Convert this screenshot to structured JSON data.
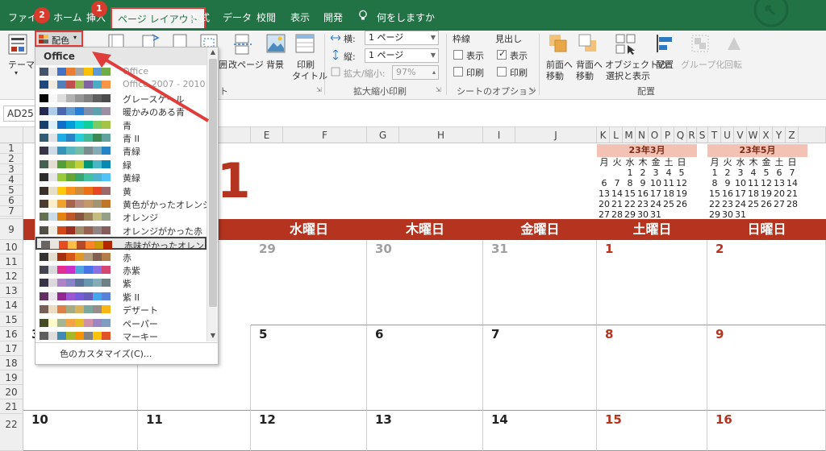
{
  "tabs": {
    "file": "ファイル",
    "home": "ホーム",
    "insert": "挿入",
    "page_layout": "ページ レイアウト",
    "formulas": "数式",
    "data": "データ",
    "review": "校閲",
    "view": "表示",
    "developer": "開発",
    "tell_me": "何をしますか"
  },
  "badges": {
    "one": "1",
    "two": "2"
  },
  "ribbon": {
    "theme_label": "テーマ",
    "colors_label": "配色",
    "range_label": "囲",
    "page_break_label": "改ページ",
    "background_label": "背景",
    "print_titles_label": "印刷",
    "print_titles_label2": "タイトル",
    "width_label": "横:",
    "width_value": "1 ページ",
    "height_label": "縦:",
    "height_value": "1 ページ",
    "scale_label": "拡大/縮小:",
    "scale_value": "97%",
    "fit_group": "拡大縮小印刷",
    "gridlines_label": "枠線",
    "headings_label": "見出し",
    "gridlines_view": "表示",
    "gridlines_print": "印刷",
    "headings_view": "表示",
    "headings_print": "印刷",
    "sheet_options_group": "シートのオプション",
    "bring_forward": "前面へ",
    "bring_forward2": "移動",
    "send_backward": "背面へ",
    "send_backward2": "移動",
    "selection_pane": "オブジェクトの",
    "selection_pane2": "選択と表示",
    "align": "配置",
    "group": "グループ化",
    "rotate": "回転",
    "arrange_group": "配置",
    "partial_group": "ト"
  },
  "namebox": "AD25",
  "columns": [
    "E",
    "F",
    "G",
    "H",
    "I",
    "J",
    "K",
    "L",
    "M",
    "N",
    "O",
    "P",
    "Q",
    "R",
    "S",
    "T",
    "U",
    "V",
    "W",
    "X",
    "Y",
    "Z"
  ],
  "rows": [
    "1",
    "2",
    "3",
    "4",
    "5",
    "6",
    "7",
    "8",
    "9",
    "10",
    "11",
    "12",
    "13",
    "14",
    "15",
    "16",
    "17",
    "18",
    "19",
    "20",
    "21",
    "22"
  ],
  "title_fragment": "/1",
  "mini_march": {
    "title": "23年3月",
    "weekdays": [
      "月",
      "火",
      "水",
      "木",
      "金",
      "土",
      "日"
    ],
    "weeks": [
      [
        "",
        "",
        "1",
        "2",
        "3",
        "4",
        "5"
      ],
      [
        "6",
        "7",
        "8",
        "9",
        "10",
        "11",
        "12"
      ],
      [
        "13",
        "14",
        "15",
        "16",
        "17",
        "18",
        "19"
      ],
      [
        "20",
        "21",
        "22",
        "23",
        "24",
        "25",
        "26"
      ],
      [
        "27",
        "28",
        "29",
        "30",
        "31",
        "",
        ""
      ]
    ]
  },
  "mini_may": {
    "title": "23年5月",
    "weekdays": [
      "月",
      "火",
      "水",
      "木",
      "金",
      "土",
      "日"
    ],
    "weeks": [
      [
        "1",
        "2",
        "3",
        "4",
        "5",
        "6",
        "7"
      ],
      [
        "8",
        "9",
        "10",
        "11",
        "12",
        "13",
        "14"
      ],
      [
        "15",
        "16",
        "17",
        "18",
        "19",
        "20",
        "21"
      ],
      [
        "22",
        "23",
        "24",
        "25",
        "26",
        "27",
        "28"
      ],
      [
        "29",
        "30",
        "31",
        "",
        "",
        "",
        ""
      ]
    ]
  },
  "daynames": [
    "水曜日",
    "木曜日",
    "金曜日",
    "土曜日",
    "日曜日"
  ],
  "calendar": {
    "week1": [
      "29",
      "30",
      "31",
      "1",
      "2"
    ],
    "week2": [
      "3",
      "5",
      "6",
      "7",
      "8",
      "9"
    ],
    "week3": [
      "10",
      "11",
      "12",
      "13",
      "14",
      "15",
      "16"
    ]
  },
  "dropdown": {
    "header": "Office",
    "customize": "色のカスタマイズ(C)...",
    "schemes": [
      {
        "name": "Office",
        "faded": true,
        "colors": [
          "#44546a",
          "#e7e6e6",
          "#4472c4",
          "#ed7d31",
          "#a5a5a5",
          "#ffc000",
          "#5b9bd5",
          "#70ad47"
        ]
      },
      {
        "name": "Office 2007 - 2010",
        "faded": true,
        "colors": [
          "#1f497d",
          "#eeece1",
          "#4f81bd",
          "#c0504d",
          "#9bbb59",
          "#8064a2",
          "#4bacc6",
          "#f79646"
        ]
      },
      {
        "name": "グレースケール",
        "colors": [
          "#000000",
          "#f8f8f8",
          "#dddddd",
          "#b2b2b2",
          "#969696",
          "#808080",
          "#5f5f5f",
          "#4d4d4d"
        ]
      },
      {
        "name": "暖かみのある青",
        "colors": [
          "#242852",
          "#acccea",
          "#4a66ac",
          "#629dd1",
          "#297fd5",
          "#7f8fa9",
          "#5aa2ae",
          "#9d90a0"
        ]
      },
      {
        "name": "青",
        "colors": [
          "#17406d",
          "#dbeff9",
          "#0f6fc6",
          "#009dd9",
          "#0bd0d9",
          "#10cf9b",
          "#7cca62",
          "#a5c249"
        ]
      },
      {
        "name": "青 II",
        "colors": [
          "#335b74",
          "#dfe3e5",
          "#1cade4",
          "#2683c6",
          "#27ced7",
          "#42ba97",
          "#3e8853",
          "#62a39f"
        ]
      },
      {
        "name": "青緑",
        "colors": [
          "#373545",
          "#cedbe6",
          "#3494ba",
          "#58b6c0",
          "#75bda7",
          "#7a8c8e",
          "#84acb6",
          "#2683c6"
        ]
      },
      {
        "name": "緑",
        "colors": [
          "#455f51",
          "#e3ded1",
          "#549e39",
          "#8ab833",
          "#c0cf3a",
          "#029676",
          "#4ab5c4",
          "#0989b1"
        ]
      },
      {
        "name": "黄緑",
        "colors": [
          "#2c2c2c",
          "#e6e6e6",
          "#99cb38",
          "#63a537",
          "#37a76f",
          "#44c1a3",
          "#4eb3cf",
          "#51c3f9"
        ]
      },
      {
        "name": "黄",
        "colors": [
          "#39302a",
          "#e5dec9",
          "#ffca08",
          "#f8931d",
          "#ce8d3e",
          "#ec7016",
          "#e64823",
          "#9c6a6a"
        ]
      },
      {
        "name": "黄色がかったオレンジ",
        "colors": [
          "#4e3b30",
          "#fbeec9",
          "#f0a22e",
          "#a5644e",
          "#b58b80",
          "#c3986d",
          "#a19574",
          "#c17529"
        ]
      },
      {
        "name": "オレンジ",
        "colors": [
          "#637052",
          "#ccddea",
          "#e48312",
          "#bd582c",
          "#865640",
          "#9b8357",
          "#c2bc80",
          "#94a088"
        ]
      },
      {
        "name": "オレンジがかった赤",
        "colors": [
          "#505046",
          "#eeece1",
          "#d34817",
          "#9b2d1f",
          "#a28e6a",
          "#956251",
          "#918485",
          "#855d5d"
        ]
      },
      {
        "name": "赤味がかったオレンジ",
        "selected": true,
        "colors": [
          "#696464",
          "#e9e5dc",
          "#e84c22",
          "#ffbd47",
          "#b64926",
          "#ff8427",
          "#cc9900",
          "#b22600"
        ]
      },
      {
        "name": "赤",
        "colors": [
          "#323232",
          "#e3ded1",
          "#a5300f",
          "#d55816",
          "#e19825",
          "#b19c7d",
          "#7f5f52",
          "#b27d49"
        ]
      },
      {
        "name": "赤紫",
        "colors": [
          "#454551",
          "#d8d9dc",
          "#e32d91",
          "#c830cc",
          "#4ea6dc",
          "#4775e7",
          "#8971e1",
          "#d54773"
        ]
      },
      {
        "name": "紫",
        "colors": [
          "#373545",
          "#dcd8dc",
          "#ad84c6",
          "#8784c7",
          "#5d739a",
          "#6997af",
          "#84acb6",
          "#6f8183"
        ]
      },
      {
        "name": "紫 II",
        "colors": [
          "#632e62",
          "#eae5eb",
          "#92278f",
          "#9b57d3",
          "#755dd9",
          "#665eb8",
          "#45a5ed",
          "#5982db"
        ]
      },
      {
        "name": "デザート",
        "colors": [
          "#775f55",
          "#ebddc3",
          "#dd8047",
          "#a5ab81",
          "#d8b25c",
          "#7ba79d",
          "#968c8c",
          "#f7b615"
        ]
      },
      {
        "name": "ペーパー",
        "colors": [
          "#444d26",
          "#fefac9",
          "#a5b592",
          "#f3a447",
          "#e7bc29",
          "#d092a7",
          "#9c85c0",
          "#809ec2"
        ]
      },
      {
        "name": "マーキー",
        "colors": [
          "#5e5e5e",
          "#ddddde",
          "#418ab3",
          "#a6b727",
          "#f69200",
          "#838383",
          "#fec306",
          "#df5327"
        ]
      }
    ]
  }
}
